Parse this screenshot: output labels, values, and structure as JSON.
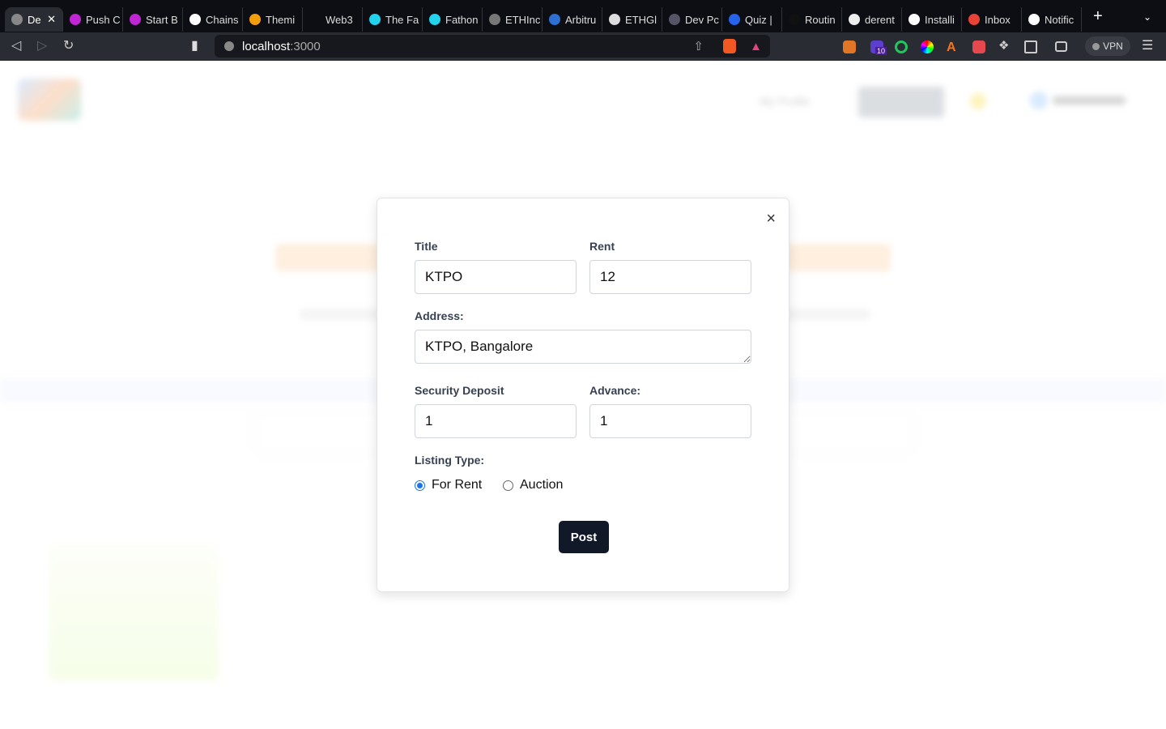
{
  "browser": {
    "tabs": [
      {
        "label": "De",
        "color": "#888"
      },
      {
        "label": "Push C",
        "color": "#c026d3"
      },
      {
        "label": "Start B",
        "color": "#c026d3"
      },
      {
        "label": "Chains",
        "color": "#fff"
      },
      {
        "label": "Themi",
        "color": "#f59e0b"
      },
      {
        "label": "Web3",
        "color": "#0d0e13"
      },
      {
        "label": "The Fa",
        "color": "#22d3ee"
      },
      {
        "label": "Fathon",
        "color": "#22d3ee"
      },
      {
        "label": "ETHInc",
        "color": "#777"
      },
      {
        "label": "Arbitru",
        "color": "#2d6fd3"
      },
      {
        "label": "ETHGl",
        "color": "#ddd"
      },
      {
        "label": "Dev Pc",
        "color": "#556"
      },
      {
        "label": "Quiz |",
        "color": "#2563eb"
      },
      {
        "label": "Routin",
        "color": "#111"
      },
      {
        "label": "derent",
        "color": "#eee"
      },
      {
        "label": "Installi",
        "color": "#fff"
      },
      {
        "label": "Inbox",
        "color": "#ea4335"
      },
      {
        "label": "Notific",
        "color": "#fff"
      }
    ],
    "new_tab": "+",
    "url_host": "localhost",
    "url_port": ":3000",
    "vpn_label": "VPN",
    "ext_badge": "10"
  },
  "background": {
    "profile_label": "My Profile",
    "accent": "#f97316"
  },
  "modal": {
    "title_label": "Title",
    "title_value": "KTPO",
    "rent_label": "Rent",
    "rent_value": "12",
    "address_label": "Address:",
    "address_value": "KTPO, Bangalore",
    "deposit_label": "Security Deposit",
    "deposit_value": "1",
    "advance_label": "Advance:",
    "advance_value": "1",
    "listing_label": "Listing Type:",
    "options": [
      {
        "label": "For Rent",
        "selected": true
      },
      {
        "label": "Auction",
        "selected": false
      }
    ],
    "post_label": "Post",
    "close": "×"
  }
}
